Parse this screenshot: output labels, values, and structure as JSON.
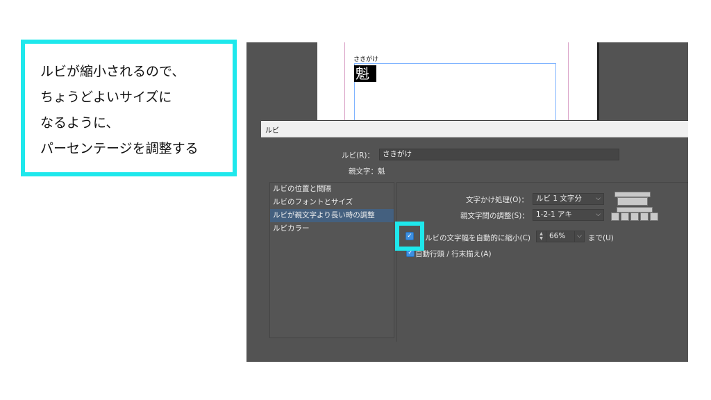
{
  "callout": {
    "lines": [
      "ルビが縮小されるので、",
      "ちょうどよいサイズに",
      "なるように、",
      "パーセンテージを調整する"
    ]
  },
  "document": {
    "ruby_text": "さきがけ",
    "base_char": "魁"
  },
  "dialog": {
    "title": "ルビ",
    "ruby_label": "ルビ(R)：",
    "ruby_value": "さきがけ",
    "base_label": "親文字：魁",
    "side_items": [
      {
        "label": "ルビの位置と間隔",
        "selected": false
      },
      {
        "label": "ルビのフォントとサイズ",
        "selected": false
      },
      {
        "label": "ルビが親文字より長い時の調整",
        "selected": true
      },
      {
        "label": "ルビカラー",
        "selected": false
      }
    ],
    "overhang_label": "文字かけ処理(O)：",
    "overhang_value": "ルビ 1 文字分",
    "spacing_label": "親文字間の調整(S)：",
    "spacing_value": "1-2-1 アキ",
    "autoshrink_label": "ルビの文字幅を自動的に縮小(C)",
    "autoshrink_checked": true,
    "percent_value": "66%",
    "until_label": "まで(U)",
    "autoalign_label": "自動行頭 / 行末揃え(A)",
    "autoalign_checked": true
  },
  "colors": {
    "highlight": "#1ee8ec",
    "dialog_bg": "#535353",
    "selected_item": "#44607f"
  }
}
